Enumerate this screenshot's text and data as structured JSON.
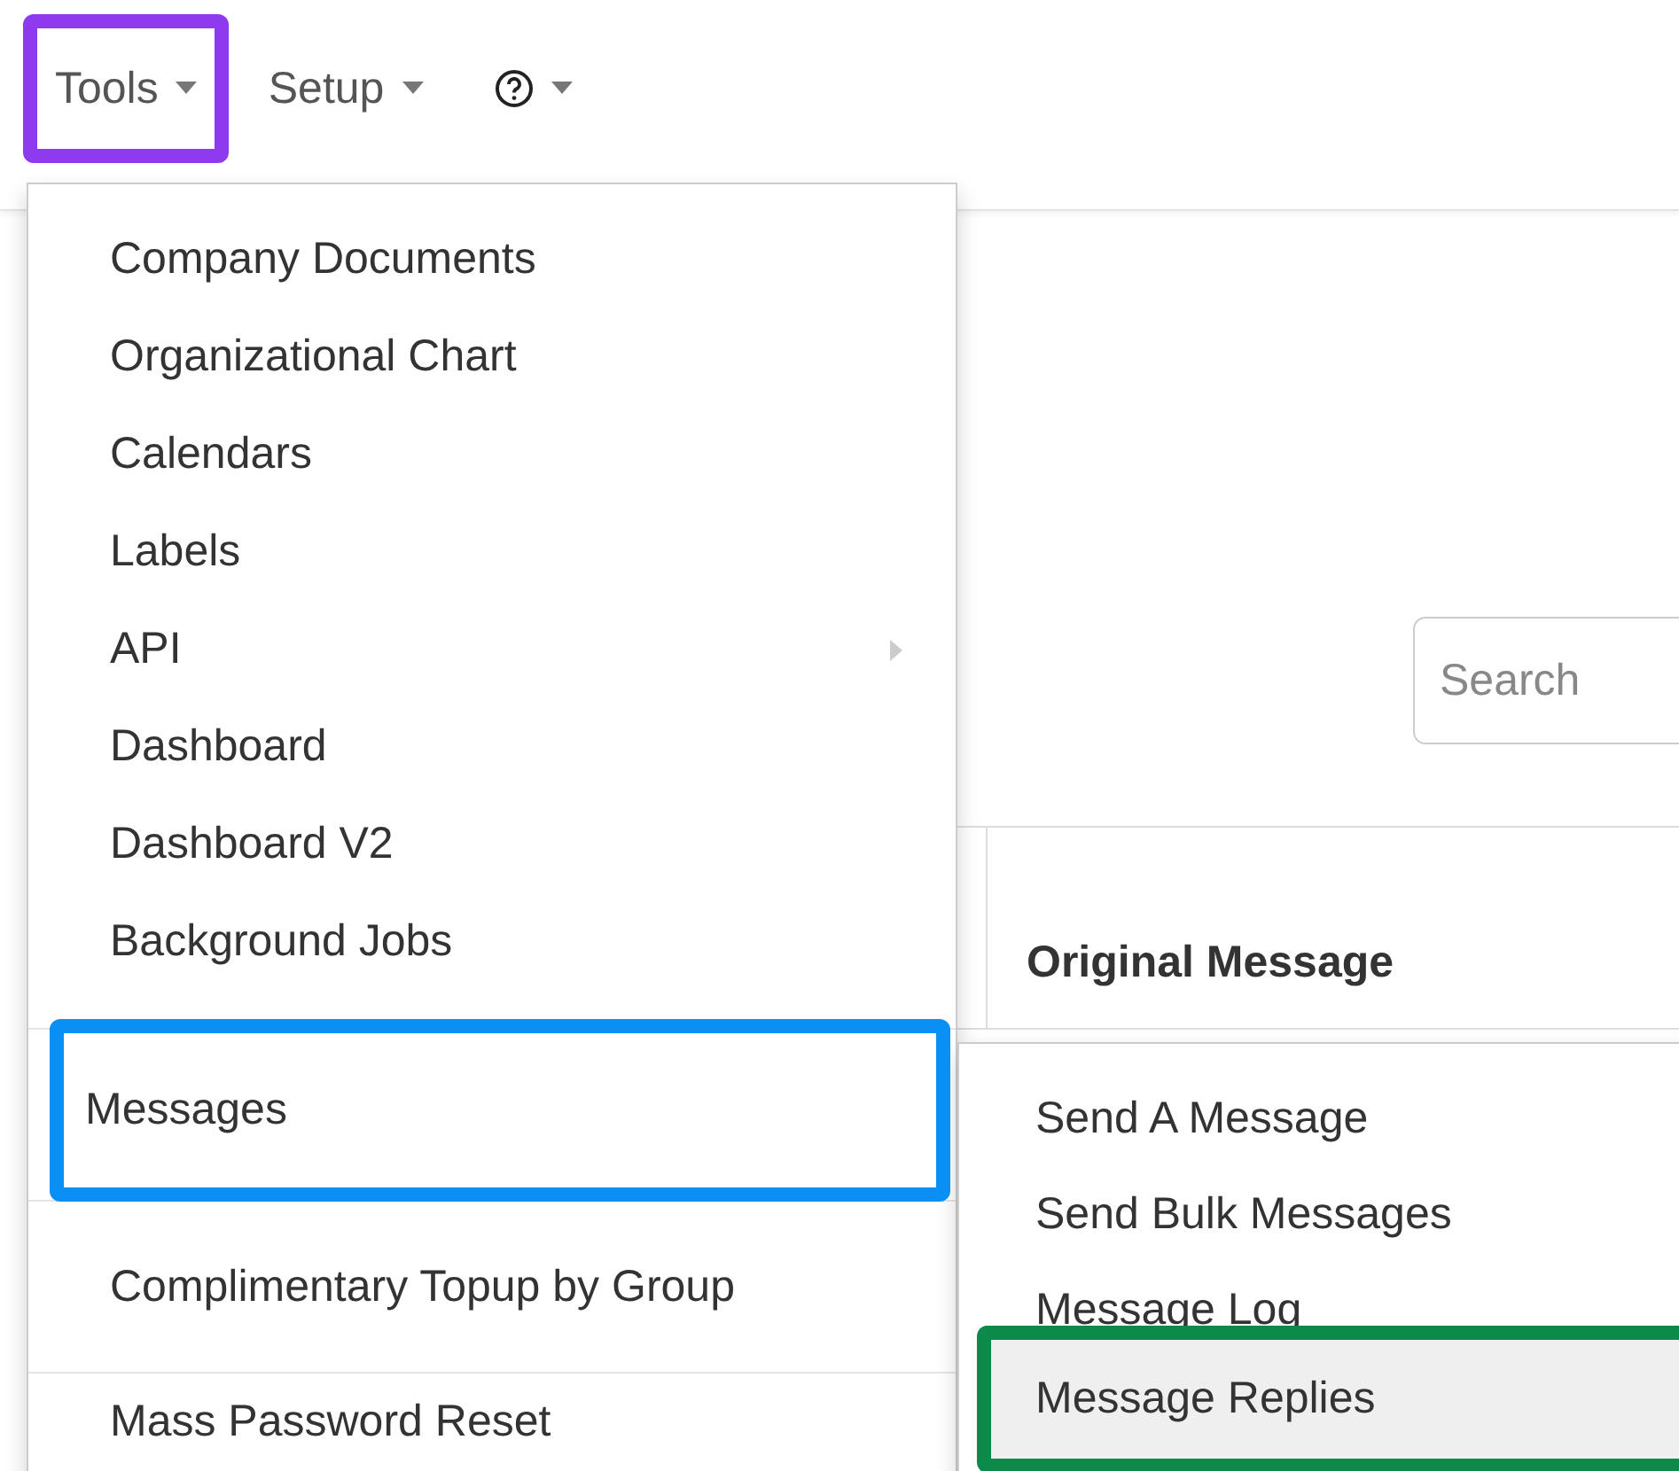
{
  "nav": [
    {
      "kind": "text",
      "label": "Tools",
      "color": "#8e3bf0"
    },
    {
      "kind": "text",
      "label": "Setup"
    },
    {
      "kind": "help"
    }
  ],
  "search": {
    "placeholder": "Search"
  },
  "table": {
    "columns": [
      "Original Message"
    ]
  },
  "menu": {
    "items": [
      {
        "kind": "link",
        "label": "Company Documents"
      },
      {
        "kind": "link",
        "label": "Organizational Chart"
      },
      {
        "kind": "link",
        "label": "Calendars"
      },
      {
        "kind": "link",
        "label": "Labels"
      },
      {
        "kind": "submenu",
        "label": "API"
      },
      {
        "kind": "link",
        "label": "Dashboard"
      },
      {
        "kind": "link",
        "label": "Dashboard V2"
      },
      {
        "kind": "link",
        "label": "Background Jobs"
      },
      {
        "kind": "divider"
      },
      {
        "kind": "group",
        "label": "Messages",
        "color": "#0a8ff5"
      },
      {
        "kind": "divider"
      },
      {
        "kind": "group",
        "label": "Complimentary Topup by Group"
      },
      {
        "kind": "divider"
      },
      {
        "kind": "link",
        "label": "Mass Password Reset"
      }
    ]
  },
  "submenu": {
    "items": [
      {
        "label": "Send A Message",
        "selected": false
      },
      {
        "label": "Send Bulk Messages",
        "selected": false
      },
      {
        "label": "Message Log",
        "selected": false
      },
      {
        "label": "Message Replies",
        "selected": true,
        "color": "#0b8a4a"
      }
    ]
  }
}
